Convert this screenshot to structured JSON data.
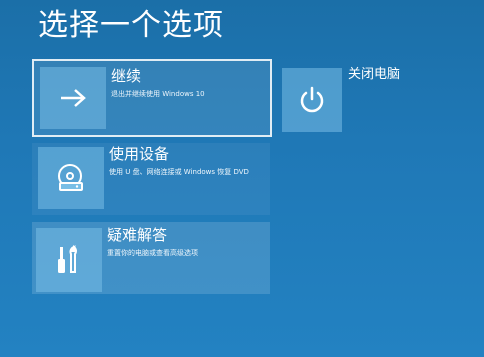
{
  "page": {
    "title": "选择一个选项"
  },
  "options": [
    {
      "title": "继续",
      "description": "退出并继续使用 Windows 10",
      "icon": "arrow-right-icon",
      "selected": true
    },
    {
      "title": "使用设备",
      "description": "使用 U 盘、网络连接或 Windows 恢复 DVD",
      "icon": "disc-drive-icon",
      "selected": false
    },
    {
      "title": "疑难解答",
      "description": "重置你的电脑或查看高级选项",
      "icon": "tools-icon",
      "selected": false
    },
    {
      "title": "关闭电脑",
      "description": "",
      "icon": "power-icon",
      "selected": false
    }
  ],
  "colors": {
    "background": "#1f78b6",
    "tile": "#78bee6",
    "text": "#ffffff"
  }
}
